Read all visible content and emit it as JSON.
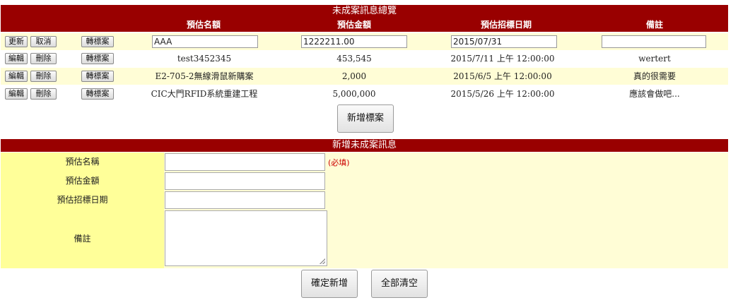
{
  "list": {
    "title": "未成案訊息總覽",
    "headers": [
      "預估名額",
      "預估金額",
      "預估招標日期",
      "備註"
    ],
    "edit_row": {
      "update_label": "更新",
      "cancel_label": "取消",
      "convert_label": "轉標案",
      "name_value": "AAA",
      "amount_value": "1222211.00",
      "date_value": "2015/07/31",
      "note_value": ""
    },
    "rows": [
      {
        "edit_label": "編輯",
        "delete_label": "刪除",
        "convert_label": "轉標案",
        "name": "test3452345",
        "amount": "453,545",
        "date": "2015/7/11 上午 12:00:00",
        "note": "wertert"
      },
      {
        "edit_label": "編輯",
        "delete_label": "刪除",
        "convert_label": "轉標案",
        "name": "E2-705-2無線滑鼠新購案",
        "amount": "2,000",
        "date": "2015/6/5 上午 12:00:00",
        "note": "真的很需要"
      },
      {
        "edit_label": "編輯",
        "delete_label": "刪除",
        "convert_label": "轉標案",
        "name": "CIC大門RFID系統重建工程",
        "amount": "5,000,000",
        "date": "2015/5/26 上午 12:00:00",
        "note": "應該會做吧..."
      }
    ],
    "add_button_label": "新增標案"
  },
  "form": {
    "title": "新增未成案訊息",
    "name_label": "預估名稱",
    "required_note": "(必填)",
    "amount_label": "預估金額",
    "date_label": "預估招標日期",
    "note_label": "備註",
    "confirm_label": "確定新增",
    "clear_label": "全部清空"
  },
  "colors": {
    "header_bg": "#990000",
    "row_alt_bg": "#fffdd6",
    "label_bg": "#ffff99",
    "required_text": "#cc0000"
  }
}
